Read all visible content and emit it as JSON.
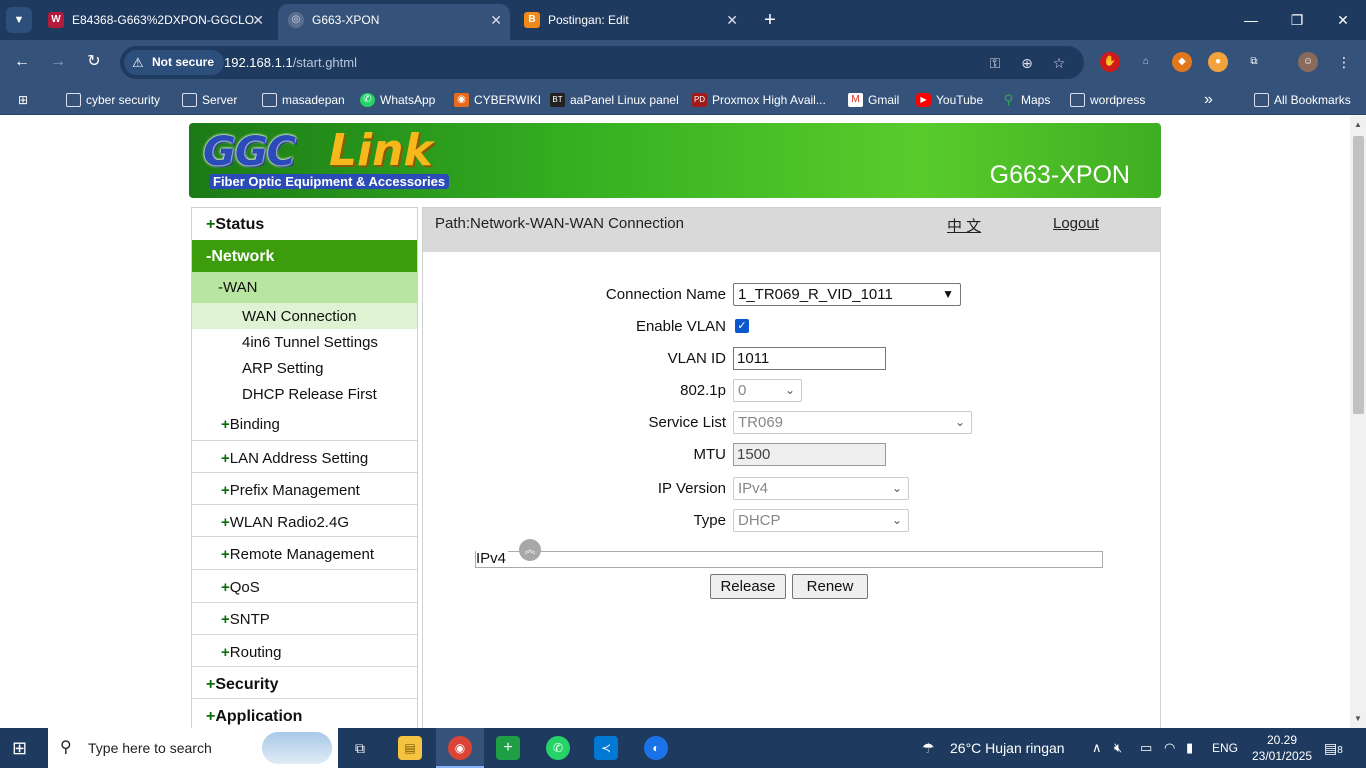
{
  "browser": {
    "tabs": [
      {
        "title": "E84368-G663%2DXPON-GGCLO",
        "active": false
      },
      {
        "title": "G663-XPON",
        "active": true
      },
      {
        "title": "Postingan: Edit",
        "active": false
      }
    ],
    "not_secure_label": "Not secure",
    "url_host": "192.168.1.1",
    "url_path": "/start.ghtml",
    "bookmarks": [
      "cyber security",
      "Server",
      "masadepan",
      "WhatsApp",
      "CYBERWIKI",
      "aaPanel Linux panel",
      "Proxmox High Avail...",
      "Gmail",
      "YouTube",
      "Maps",
      "wordpress"
    ],
    "all_bookmarks": "All Bookmarks",
    "overflow": "»"
  },
  "banner": {
    "logo_g": "GGC",
    "logo_link": "Link",
    "tagline": "Fiber Optic Equipment & Accessories",
    "model": "G663-XPON"
  },
  "sidebar": {
    "status": "Status",
    "network": "Network",
    "wan": "WAN",
    "wan_items": [
      "WAN Connection",
      "4in6 Tunnel Settings",
      "ARP Setting",
      "DHCP Release First"
    ],
    "network_subs": [
      "Binding",
      "LAN Address Setting",
      "Prefix Management",
      "WLAN Radio2.4G",
      "Remote Management",
      "QoS",
      "SNTP",
      "Routing"
    ],
    "security": "Security",
    "application": "Application"
  },
  "content": {
    "path": "Path:Network-WAN-WAN Connection",
    "lang": "中 文",
    "logout": "Logout",
    "fields": {
      "connection_name_label": "Connection Name",
      "connection_name_value": "1_TR069_R_VID_1011",
      "enable_vlan_label": "Enable VLAN",
      "enable_vlan_checked": true,
      "vlan_id_label": "VLAN ID",
      "vlan_id_value": "1011",
      "p8021_label": "802.1p",
      "p8021_value": "0",
      "service_list_label": "Service List",
      "service_list_value": "TR069",
      "mtu_label": "MTU",
      "mtu_value": "1500",
      "ip_version_label": "IP Version",
      "ip_version_value": "IPv4",
      "type_label": "Type",
      "type_value": "DHCP"
    },
    "ipv4_section": "IPv4",
    "release_button": "Release",
    "renew_button": "Renew"
  },
  "taskbar": {
    "search_placeholder": "Type here to search",
    "weather": "26°C  Hujan ringan",
    "lang": "ENG",
    "time": "20.29",
    "date": "23/01/2025",
    "notifications": "8"
  },
  "colors": {
    "menu_active": "#3c9c0c",
    "menu_sub_active": "#b8e6a0",
    "menu_leaf_active": "#dff3d2",
    "banner_green": "#3fae22"
  }
}
